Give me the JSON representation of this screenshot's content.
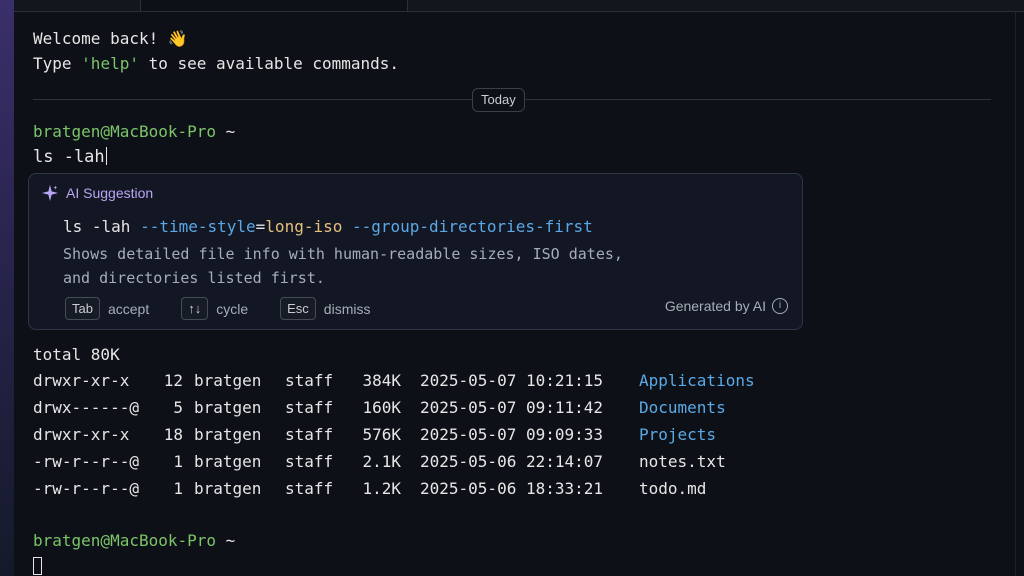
{
  "welcome": {
    "line1": "Welcome back! 👋",
    "line2_prefix": "Type ",
    "line2_keyword": "'help'",
    "line2_suffix": " to see available commands."
  },
  "divider_label": "Today",
  "prompt1": {
    "user_host": "bratgen@MacBook-Pro",
    "dir": "~",
    "command": "ls -lah"
  },
  "ai_suggestion": {
    "title": "AI Suggestion",
    "cmd_base": "ls -lah ",
    "flag1": "--time-style",
    "eq": "=",
    "val1": "long-iso",
    "flag2": " --group-directories-first",
    "description_line1": "Shows detailed file info with human-readable sizes, ISO dates,",
    "description_line2": "and directories listed first.",
    "hints": [
      {
        "key": "Tab",
        "label": "accept"
      },
      {
        "key": "↑↓",
        "label": "cycle"
      },
      {
        "key": "Esc",
        "label": "dismiss"
      }
    ],
    "generated_label": "Generated by AI",
    "info_glyph": "i"
  },
  "listing": {
    "total": "total 80K",
    "rows": [
      {
        "perm": "drwxr-xr-x",
        "links": "12",
        "owner": "bratgen",
        "group": "staff",
        "size": "384K",
        "date": "2025-05-07 10:21:15",
        "name": "Applications",
        "is_dir": true
      },
      {
        "perm": "drwx------@",
        "links": "5",
        "owner": "bratgen",
        "group": "staff",
        "size": "160K",
        "date": "2025-05-07 09:11:42",
        "name": "Documents",
        "is_dir": true
      },
      {
        "perm": "drwxr-xr-x",
        "links": "18",
        "owner": "bratgen",
        "group": "staff",
        "size": "576K",
        "date": "2025-05-07 09:09:33",
        "name": "Projects",
        "is_dir": true
      },
      {
        "perm": "-rw-r--r--@",
        "links": "1",
        "owner": "bratgen",
        "group": "staff",
        "size": "2.1K",
        "date": "2025-05-06 22:14:07",
        "name": "notes.txt",
        "is_dir": false
      },
      {
        "perm": "-rw-r--r--@",
        "links": "1",
        "owner": "bratgen",
        "group": "staff",
        "size": "1.2K",
        "date": "2025-05-06 18:33:21",
        "name": "todo.md",
        "is_dir": false
      }
    ]
  },
  "prompt2": {
    "user_host": "bratgen@MacBook-Pro",
    "dir": "~"
  },
  "colors": {
    "prompt_green": "#7cc46a",
    "dir_blue": "#5aa9e6",
    "ai_purple": "#b9a6f5",
    "flag_yellow": "#e5c07b"
  }
}
